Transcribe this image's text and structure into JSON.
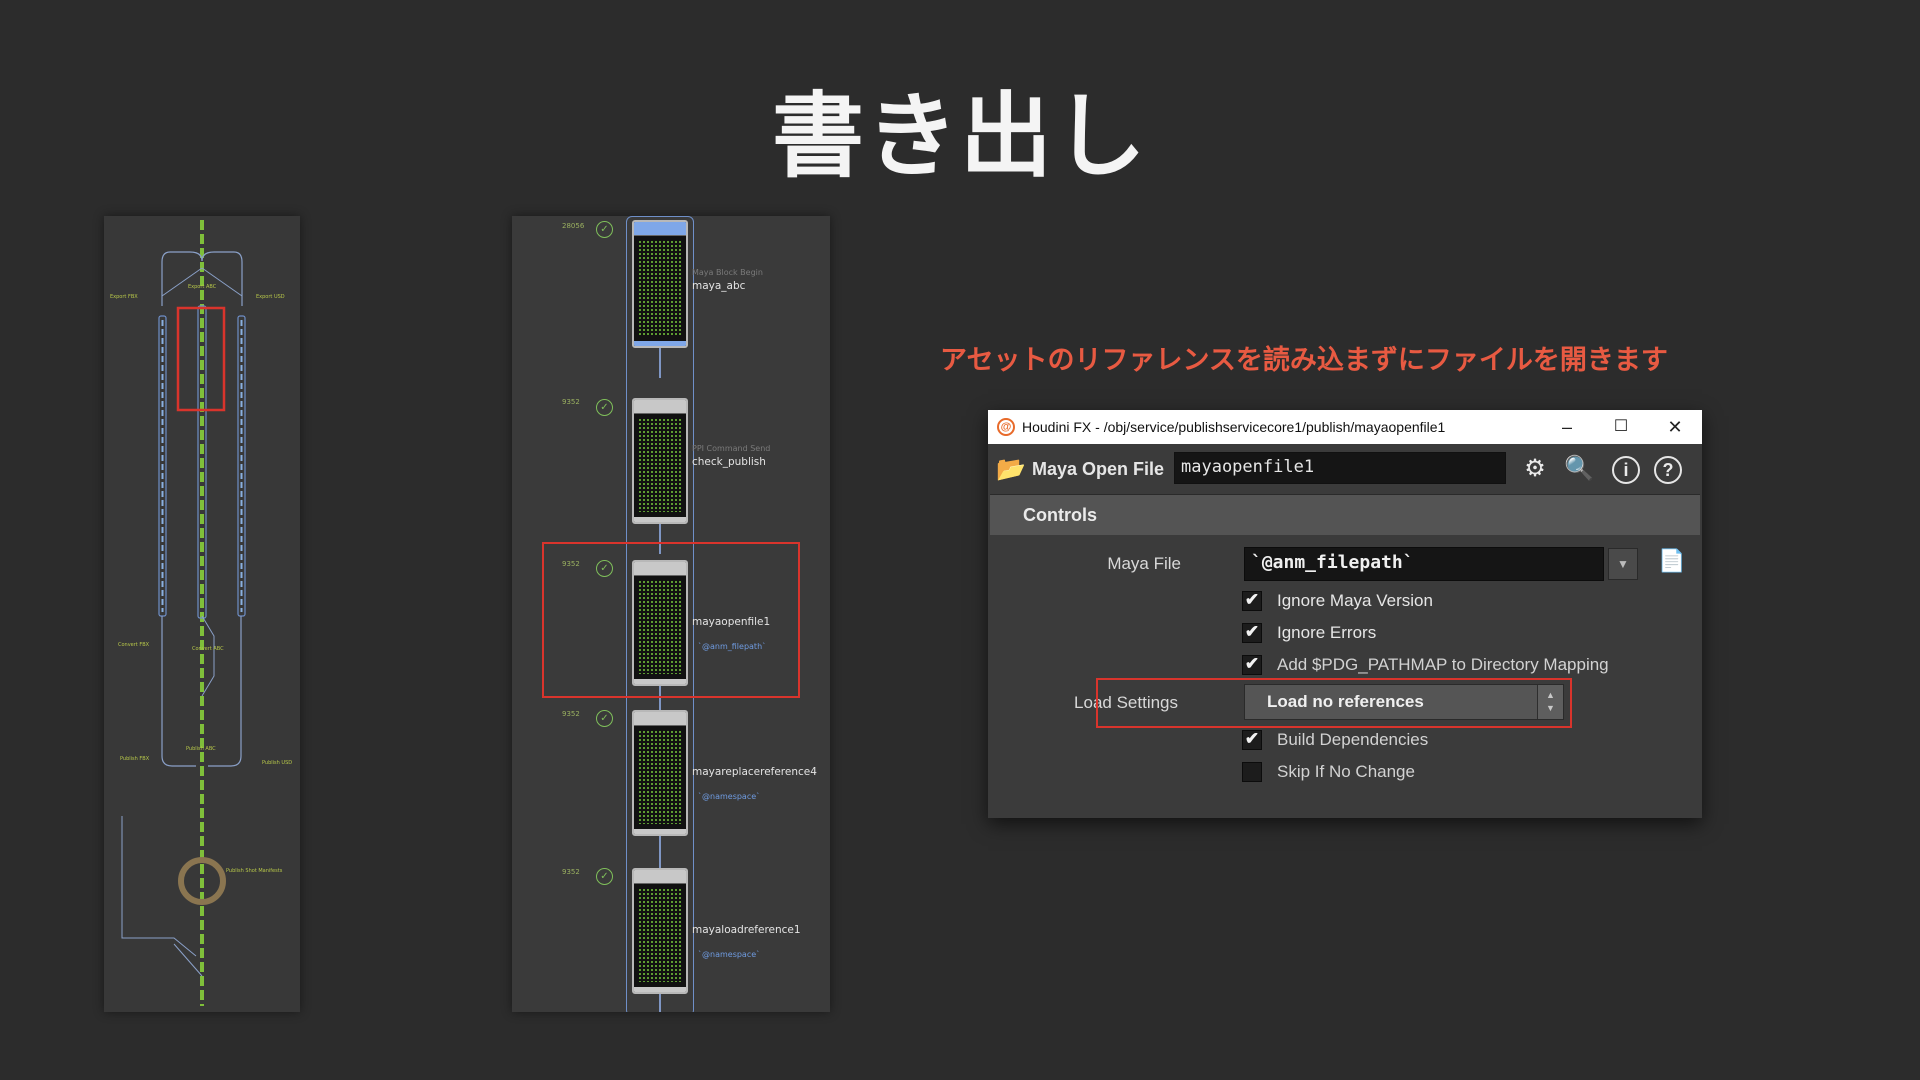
{
  "slide": {
    "title": "書き出し",
    "caption": "アセットのリファレンスを読み込まずにファイルを開きます"
  },
  "overview": {
    "labels": [
      {
        "text": "Export FBX"
      },
      {
        "text": "Export ABC"
      },
      {
        "text": "Export USD"
      },
      {
        "text": "Convert FBX"
      },
      {
        "text": "Convert ABC"
      },
      {
        "text": "Publish FBX"
      },
      {
        "text": "Publish ABC"
      },
      {
        "text": "Publish USD"
      },
      {
        "text": "Publish Shot Manifests"
      }
    ]
  },
  "chain": {
    "nodes": [
      {
        "count": "28056",
        "type": "Maya Block Begin",
        "name": "maya_abc",
        "expr": "",
        "color": "blue"
      },
      {
        "count": "9352",
        "type": "PPI Command Send",
        "name": "check_publish",
        "expr": "",
        "color": "gray"
      },
      {
        "count": "9352",
        "type": "",
        "name": "mayaopenfile1",
        "expr": "`@anm_filepath`",
        "color": "gray"
      },
      {
        "count": "9352",
        "type": "",
        "name": "mayareplacereference4",
        "expr": "`@namespace`",
        "color": "gray"
      },
      {
        "count": "9352",
        "type": "",
        "name": "mayaloadreference1",
        "expr": "`@namespace`",
        "color": "gray"
      }
    ]
  },
  "window": {
    "title": "Houdini FX - /obj/service/publishservicecore1/publish/mayaopenfile1",
    "minimize": "–",
    "maximize": "☐",
    "close": "✕",
    "node_type": "Maya Open File",
    "node_name": "mayaopenfile1",
    "section": "Controls",
    "maya_file_label": "Maya File",
    "maya_file_value": "`@anm_filepath`",
    "checkboxes_top": [
      {
        "label": "Ignore Maya Version",
        "checked": true
      },
      {
        "label": "Ignore Errors",
        "checked": true
      },
      {
        "label": "Add $PDG_PATHMAP to Directory Mapping",
        "checked": true
      }
    ],
    "load_settings_label": "Load Settings",
    "load_settings_value": "Load no references",
    "checkboxes_bottom": [
      {
        "label": "Build Dependencies",
        "checked": true
      },
      {
        "label": "Skip If No Change",
        "checked": false
      }
    ],
    "highlight_color": "#d9342c",
    "caption_color": "#e85a42"
  }
}
